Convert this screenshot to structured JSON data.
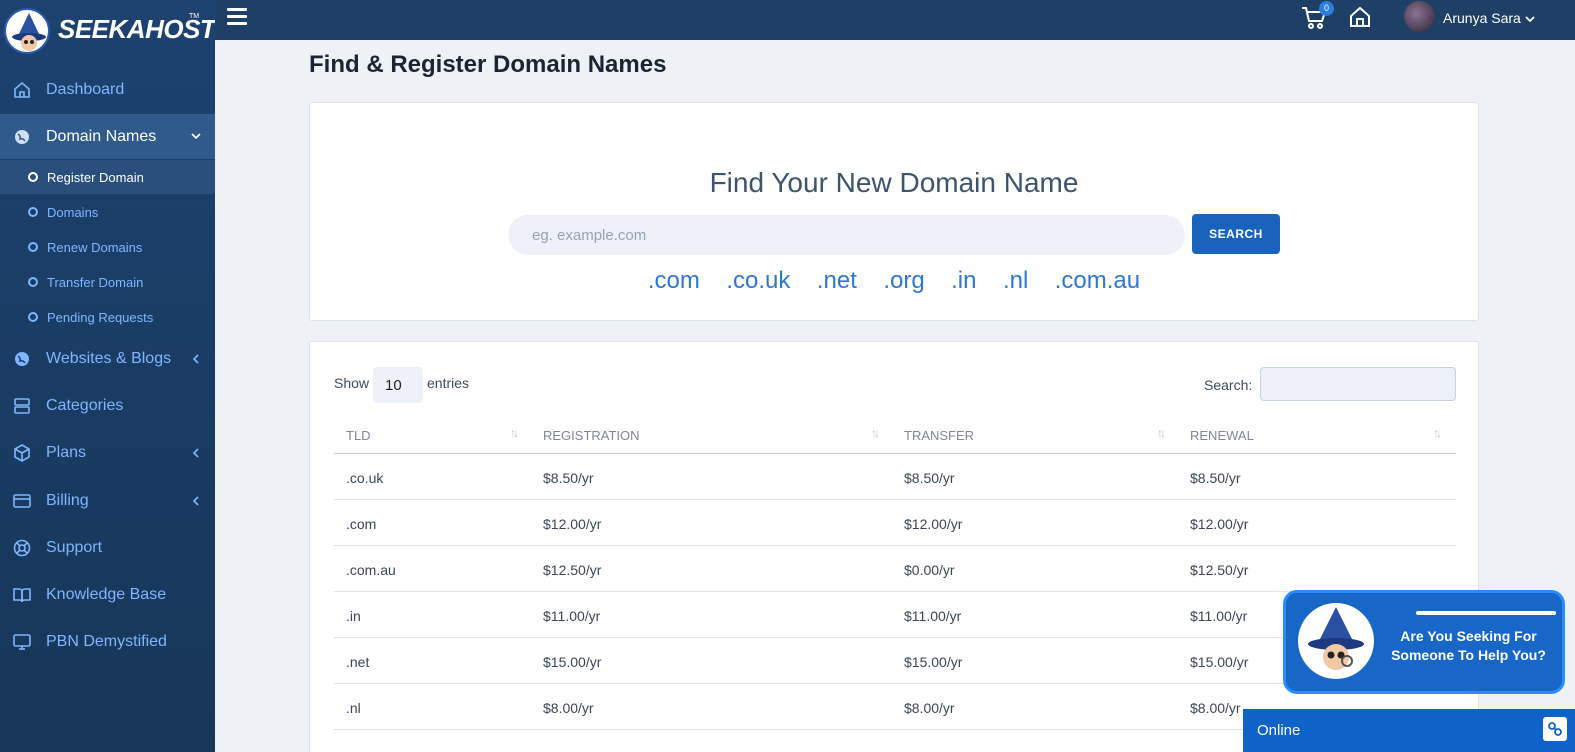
{
  "brand": {
    "name": "SEEKAHOST",
    "tm": "TM"
  },
  "topbar": {
    "cart_count": "0",
    "user_name": "Arunya Sara"
  },
  "sidebar": {
    "items": [
      {
        "label": "Dashboard",
        "icon": "home-icon"
      },
      {
        "label": "Domain Names",
        "icon": "globe-icon"
      },
      {
        "label": "Websites & Blogs",
        "icon": "globe-icon"
      },
      {
        "label": "Categories",
        "icon": "server-icon"
      },
      {
        "label": "Plans",
        "icon": "box-icon"
      },
      {
        "label": "Billing",
        "icon": "credit-card-icon"
      },
      {
        "label": "Support",
        "icon": "lifebuoy-icon"
      },
      {
        "label": "Knowledge Base",
        "icon": "book-icon"
      },
      {
        "label": "PBN Demystified",
        "icon": "monitor-icon"
      }
    ],
    "sub_items": [
      {
        "label": "Register Domain"
      },
      {
        "label": "Domains"
      },
      {
        "label": "Renew Domains"
      },
      {
        "label": "Transfer Domain"
      },
      {
        "label": "Pending Requests"
      }
    ]
  },
  "page": {
    "title": "Find & Register Domain Names"
  },
  "finder": {
    "title": "Find Your New Domain Name",
    "placeholder": "eg. example.com",
    "button": "SEARCH",
    "tlds": [
      ".com",
      ".co.uk",
      ".net",
      ".org",
      ".in",
      ".nl",
      ".com.au"
    ]
  },
  "table": {
    "show_label": "Show",
    "entries_value": "10",
    "entries_label": "entries",
    "search_label": "Search:",
    "headers": [
      "TLD",
      "REGISTRATION",
      "TRANSFER",
      "RENEWAL"
    ],
    "rows": [
      [
        ".co.uk",
        "$8.50/yr",
        "$8.50/yr",
        "$8.50/yr"
      ],
      [
        ".com",
        "$12.00/yr",
        "$12.00/yr",
        "$12.00/yr"
      ],
      [
        ".com.au",
        "$12.50/yr",
        "$0.00/yr",
        "$12.50/yr"
      ],
      [
        ".in",
        "$11.00/yr",
        "$11.00/yr",
        "$11.00/yr"
      ],
      [
        ".net",
        "$15.00/yr",
        "$15.00/yr",
        "$15.00/yr"
      ],
      [
        ".nl",
        "$8.00/yr",
        "$8.00/yr",
        "$8.00/yr"
      ]
    ]
  },
  "chat": {
    "line1": "Are You Seeking For",
    "line2": "Someone To Help You?",
    "status": "Online"
  },
  "colors": {
    "sidebar": "#1d4270",
    "topbar": "#1e3f66",
    "accent": "#1a63bd",
    "link": "#2f77d0"
  }
}
